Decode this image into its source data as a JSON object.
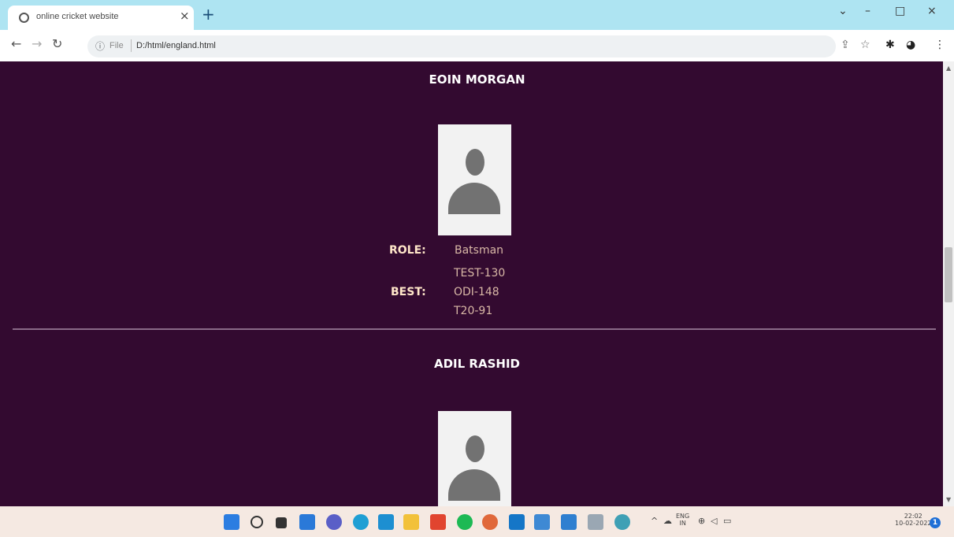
{
  "browser": {
    "tab_title": "online cricket website",
    "tab_close": "×",
    "new_tab": "+",
    "controls": {
      "minimize": "–",
      "maximize": "□",
      "close": "×"
    },
    "url_scheme": "File",
    "url": "D:/html/england.html"
  },
  "players": [
    {
      "name": "EOIN MORGAN",
      "role_label": "ROLE:",
      "role": "Batsman",
      "best_label": "BEST:",
      "best": [
        "TEST-130",
        "ODI-148",
        "T20-91"
      ]
    },
    {
      "name": "ADIL RASHID"
    }
  ],
  "taskbar": {
    "language": "ENG",
    "region": "IN",
    "time": "22:02",
    "date": "10-02-2022",
    "notification_count": "1"
  },
  "colors": {
    "page_background": "#330a30",
    "label": "#ffe6c9",
    "value": "#d9b8a6",
    "tabstrip": "#aee4f2"
  }
}
